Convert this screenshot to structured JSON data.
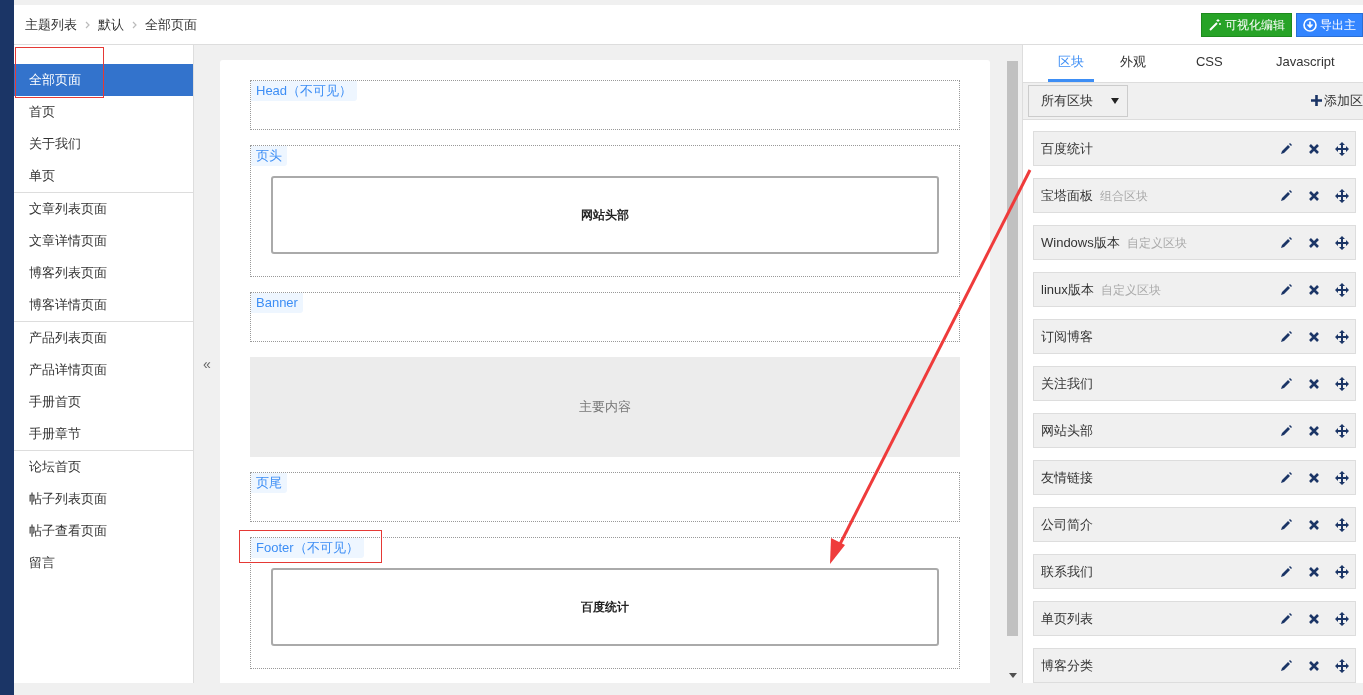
{
  "breadcrumb": [
    "主题列表",
    "默认",
    "全部页面"
  ],
  "header_buttons": [
    {
      "kind": "visual",
      "label": "可视化编辑"
    },
    {
      "kind": "export",
      "label": "导出主"
    }
  ],
  "sidebar": {
    "groups": [
      [
        {
          "label": "全部页面",
          "selected": true
        },
        {
          "label": "首页",
          "selected": false
        },
        {
          "label": "关于我们",
          "selected": false
        },
        {
          "label": "单页",
          "selected": false
        }
      ],
      [
        {
          "label": "文章列表页面",
          "selected": false
        },
        {
          "label": "文章详情页面",
          "selected": false
        },
        {
          "label": "博客列表页面",
          "selected": false
        },
        {
          "label": "博客详情页面",
          "selected": false
        }
      ],
      [
        {
          "label": "产品列表页面",
          "selected": false
        },
        {
          "label": "产品详情页面",
          "selected": false
        },
        {
          "label": "手册首页",
          "selected": false
        },
        {
          "label": "手册章节",
          "selected": false
        }
      ],
      [
        {
          "label": "论坛首页",
          "selected": false
        },
        {
          "label": "帖子列表页面",
          "selected": false
        },
        {
          "label": "帖子查看页面",
          "selected": false
        },
        {
          "label": "留言",
          "selected": false
        }
      ]
    ]
  },
  "collapse_toggle": "«",
  "canvas": {
    "sections": [
      {
        "kind": "region",
        "label": "Head（不可见）"
      },
      {
        "kind": "region",
        "label": "页头",
        "block": "网站头部"
      },
      {
        "kind": "region",
        "label": "Banner"
      },
      {
        "kind": "content",
        "text": "主要内容"
      },
      {
        "kind": "region",
        "label": "页尾"
      },
      {
        "kind": "region",
        "label": "Footer（不可见）",
        "block": "百度统计"
      }
    ]
  },
  "right_panel": {
    "tabs": [
      {
        "label": "区块",
        "selected": true
      },
      {
        "label": "外观",
        "selected": false
      },
      {
        "label": "CSS",
        "selected": false
      },
      {
        "label": "Javascript",
        "selected": false
      }
    ],
    "filter": {
      "value": "所有区块"
    },
    "add_button": "添加区",
    "blocks": [
      {
        "name": "百度统计"
      },
      {
        "name": "宝塔面板",
        "type": "组合区块"
      },
      {
        "name": "Windows版本",
        "type": "自定义区块"
      },
      {
        "name": "linux版本",
        "type": "自定义区块"
      },
      {
        "name": "订阅博客"
      },
      {
        "name": "关注我们"
      },
      {
        "name": "网站头部"
      },
      {
        "name": "友情链接"
      },
      {
        "name": "公司简介"
      },
      {
        "name": "联系我们"
      },
      {
        "name": "单页列表"
      },
      {
        "name": "博客分类"
      }
    ]
  }
}
